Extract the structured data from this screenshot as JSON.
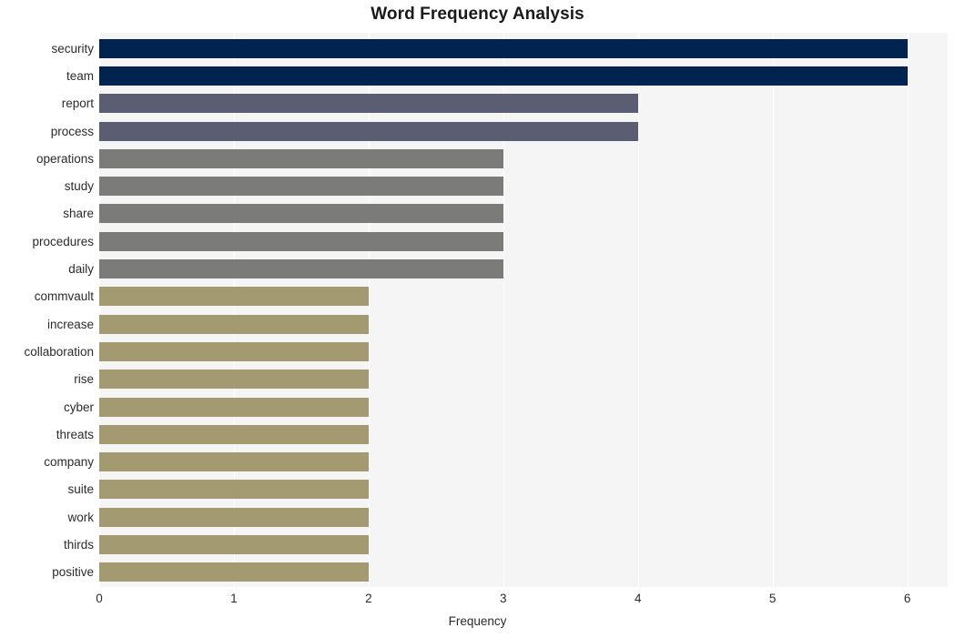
{
  "chart_data": {
    "type": "bar",
    "orientation": "horizontal",
    "title": "Word Frequency Analysis",
    "xlabel": "Frequency",
    "ylabel": "",
    "xlim": [
      0,
      6.3
    ],
    "xticks": [
      0,
      1,
      2,
      3,
      4,
      5,
      6
    ],
    "xtick_labels": [
      "0",
      "1",
      "2",
      "3",
      "4",
      "5",
      "6"
    ],
    "grid": true,
    "grid_axis": "x",
    "legend": false,
    "categories": [
      "security",
      "team",
      "report",
      "process",
      "operations",
      "study",
      "share",
      "procedures",
      "daily",
      "commvault",
      "increase",
      "collaboration",
      "rise",
      "cyber",
      "threats",
      "company",
      "suite",
      "work",
      "thirds",
      "positive"
    ],
    "values": [
      6,
      6,
      4,
      4,
      3,
      3,
      3,
      3,
      3,
      2,
      2,
      2,
      2,
      2,
      2,
      2,
      2,
      2,
      2,
      2
    ],
    "bar_colors": [
      "#00234f",
      "#00234f",
      "#5b5e73",
      "#5b5e73",
      "#7b7b79",
      "#7b7b79",
      "#7b7b79",
      "#7b7b79",
      "#7b7b79",
      "#a39a72",
      "#a39a72",
      "#a39a72",
      "#a39a72",
      "#a39a72",
      "#a39a72",
      "#a39a72",
      "#a39a72",
      "#a39a72",
      "#a39a72",
      "#a39a72"
    ]
  },
  "style": {
    "figure_background": "#ffffff",
    "plot_background": "#f5f5f5",
    "gridline_color": "#ffffff",
    "text_color": "#2b2b2b",
    "title_color": "#1a1a1a"
  }
}
